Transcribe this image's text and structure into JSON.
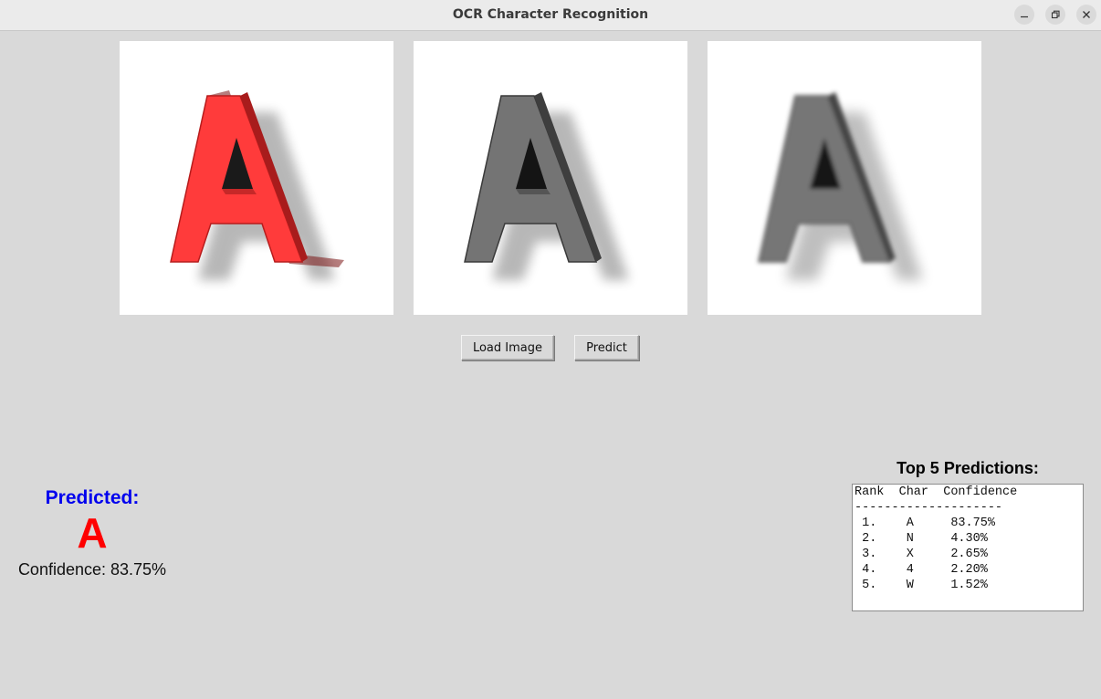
{
  "window": {
    "title": "OCR Character Recognition",
    "controls": [
      "minimize-icon",
      "restore-icon",
      "close-icon"
    ]
  },
  "images": [
    {
      "name": "original",
      "letter": "A",
      "color": "#ff3b3b"
    },
    {
      "name": "grayscale",
      "letter": "A",
      "color": "#6e6e6e"
    },
    {
      "name": "blurred",
      "letter": "A",
      "color": "#707070"
    }
  ],
  "buttons": {
    "load_label": "Load Image",
    "predict_label": "Predict"
  },
  "result": {
    "label": "Predicted:",
    "char": "A",
    "confidence_text": "Confidence: 83.75%"
  },
  "top5": {
    "title": "Top 5 Predictions:",
    "header": "Rank  Char  Confidence",
    "separator": "--------------------",
    "rows": [
      " 1.    A     83.75%",
      " 2.    N     4.30%",
      " 3.    X     2.65%",
      " 4.    4     2.20%",
      " 5.    W     1.52%"
    ]
  },
  "colors": {
    "background": "#d9d9d9",
    "predicted_label": "#0000ee",
    "predicted_char": "#ff0000"
  }
}
